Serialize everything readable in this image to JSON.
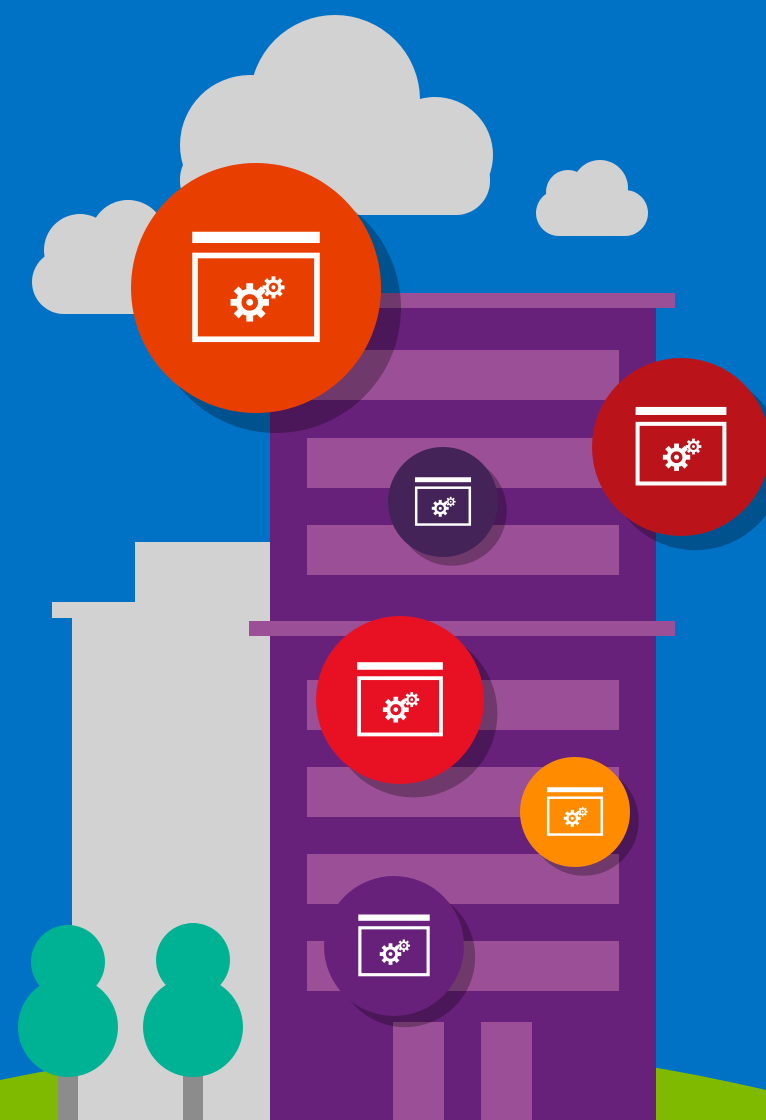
{
  "colors": {
    "sky": "#0072c6",
    "cloud": "#d2d2d2",
    "grass": "#7fba00",
    "tower": "#68217a",
    "tower_accent": "#9b4f96",
    "side_building": "#d2d2d2",
    "tree": "#00b294",
    "trunk": "#8c8c8c",
    "shadow": "#000000",
    "icon": "#ffffff"
  },
  "scene": {
    "clouds": 3,
    "trees": 2,
    "tower_floor_bands": 7,
    "tower_doors": 2
  },
  "app_icons": [
    {
      "name": "app-icon-large-orange",
      "color": "#e83e00",
      "glyph": "window-gears-icon"
    },
    {
      "name": "app-icon-dark-red",
      "color": "#ba141a",
      "glyph": "window-gears-icon"
    },
    {
      "name": "app-icon-dark-purple",
      "color": "#442359",
      "glyph": "window-gears-icon"
    },
    {
      "name": "app-icon-red",
      "color": "#e81123",
      "glyph": "window-gears-icon"
    },
    {
      "name": "app-icon-orange",
      "color": "#ff8c00",
      "glyph": "window-gears-icon"
    },
    {
      "name": "app-icon-purple",
      "color": "#68217a",
      "glyph": "window-gears-icon"
    }
  ]
}
